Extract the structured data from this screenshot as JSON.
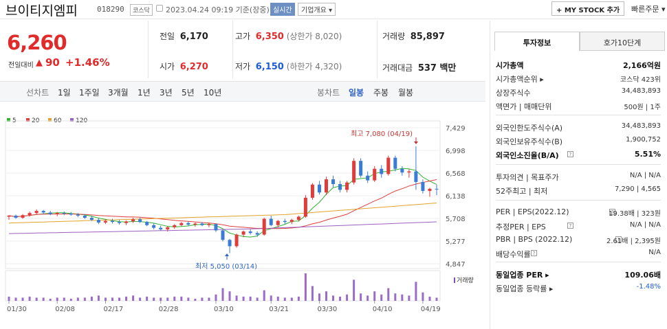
{
  "header": {
    "stock_name": "브이티지엠피",
    "code": "018290",
    "market": "코스닥",
    "datetime": "2023.04.24 09:19 기준(장중)",
    "realtime": "실시간",
    "company_info": "기업개요 ▾",
    "my_stock": "+ MY STOCK 추가",
    "quick_order": "빠른주문 ▾"
  },
  "price": {
    "current": "6,260",
    "change_label": "전일대비",
    "change_arrow": "▲",
    "change": "90",
    "change_pct": "+1.46%"
  },
  "quotes": {
    "prev_close_label": "전일",
    "prev_close": "6,170",
    "high_label": "고가",
    "high": "6,350",
    "upper_limit": "(상한가 8,020)",
    "volume_label": "거래량",
    "volume": "85,897",
    "open_label": "시가",
    "open": "6,270",
    "low_label": "저가",
    "low": "6,150",
    "lower_limit": "(하한가 4,320)",
    "amount_label": "거래대금",
    "amount": "537 백만"
  },
  "periods": {
    "line_label": "선차트",
    "items": [
      "1일",
      "1주일",
      "3개월",
      "1년",
      "3년",
      "5년",
      "10년"
    ],
    "candle_label": "봉차트",
    "candle_items": [
      "일봉",
      "주봉",
      "월봉"
    ],
    "candle_active": "일봉"
  },
  "legend": {
    "ma5": "5",
    "ma20": "20",
    "ma60": "60",
    "ma120": "120",
    "color5": "#2db32d",
    "color20": "#e03c3c",
    "color60": "#e3a22a",
    "color120": "#9b5fc0"
  },
  "chart_data": {
    "type": "candlestick",
    "y_ticks": [
      "7,429",
      "6,998",
      "6,568",
      "6,138",
      "5,708",
      "5,277",
      "4,847"
    ],
    "ylim": [
      4847,
      7429
    ],
    "x_ticks": [
      "01/30",
      "02/08",
      "02/17",
      "02/28",
      "03/10",
      "03/21",
      "03/30",
      "04/10",
      "04/19"
    ],
    "high_note": "최고 7,080 (04/19)",
    "low_note": "최저 5,050 (03/14)",
    "volume_label": "거래량",
    "up_color": "#e03c3c",
    "down_color": "#3a7bd5",
    "candles": [
      [
        5740,
        5770,
        5680,
        5760
      ],
      [
        5760,
        5780,
        5700,
        5720
      ],
      [
        5720,
        5790,
        5700,
        5770
      ],
      [
        5770,
        5840,
        5740,
        5810
      ],
      [
        5810,
        5880,
        5780,
        5850
      ],
      [
        5850,
        5870,
        5790,
        5820
      ],
      [
        5820,
        5850,
        5770,
        5790
      ],
      [
        5790,
        5830,
        5750,
        5810
      ],
      [
        5810,
        5840,
        5770,
        5800
      ],
      [
        5800,
        5830,
        5760,
        5780
      ],
      [
        5780,
        5810,
        5730,
        5760
      ],
      [
        5760,
        5790,
        5700,
        5720
      ],
      [
        5720,
        5760,
        5660,
        5680
      ],
      [
        5680,
        5720,
        5600,
        5630
      ],
      [
        5630,
        5690,
        5600,
        5660
      ],
      [
        5660,
        5700,
        5610,
        5640
      ],
      [
        5640,
        5680,
        5590,
        5620
      ],
      [
        5620,
        5670,
        5580,
        5650
      ],
      [
        5650,
        5720,
        5620,
        5690
      ],
      [
        5690,
        5720,
        5620,
        5640
      ],
      [
        5640,
        5660,
        5560,
        5580
      ],
      [
        5580,
        5620,
        5500,
        5530
      ],
      [
        5530,
        5570,
        5470,
        5500
      ],
      [
        5500,
        5560,
        5460,
        5540
      ],
      [
        5540,
        5600,
        5510,
        5580
      ],
      [
        5580,
        5640,
        5560,
        5620
      ],
      [
        5620,
        5650,
        5560,
        5590
      ],
      [
        5590,
        5630,
        5550,
        5610
      ],
      [
        5610,
        5640,
        5560,
        5580
      ],
      [
        5580,
        5620,
        5540,
        5600
      ],
      [
        5600,
        5610,
        5450,
        5480
      ],
      [
        5480,
        5500,
        5270,
        5300
      ],
      [
        5300,
        5320,
        5050,
        5180
      ],
      [
        5180,
        5420,
        5150,
        5400
      ],
      [
        5400,
        5480,
        5350,
        5460
      ],
      [
        5460,
        5500,
        5400,
        5430
      ],
      [
        5430,
        5460,
        5360,
        5400
      ],
      [
        5400,
        5720,
        5380,
        5700
      ],
      [
        5700,
        5760,
        5560,
        5580
      ],
      [
        5580,
        5680,
        5540,
        5660
      ],
      [
        5660,
        5700,
        5600,
        5640
      ],
      [
        5640,
        5700,
        5600,
        5680
      ],
      [
        5680,
        5760,
        5650,
        5740
      ],
      [
        5740,
        6150,
        5720,
        6100
      ],
      [
        6100,
        6380,
        6060,
        6350
      ],
      [
        6350,
        6420,
        6160,
        6200
      ],
      [
        6200,
        6500,
        6150,
        6450
      ],
      [
        6450,
        6520,
        6300,
        6360
      ],
      [
        6360,
        6420,
        6200,
        6250
      ],
      [
        6250,
        6420,
        6200,
        6390
      ],
      [
        6390,
        6850,
        6350,
        6800
      ],
      [
        6800,
        6850,
        6480,
        6520
      ],
      [
        6520,
        6600,
        6380,
        6430
      ],
      [
        6430,
        6700,
        6400,
        6650
      ],
      [
        6650,
        6720,
        6480,
        6550
      ],
      [
        6550,
        6900,
        6520,
        6860
      ],
      [
        6860,
        6900,
        6600,
        6650
      ],
      [
        6650,
        6700,
        6520,
        6580
      ],
      [
        6580,
        6640,
        6480,
        6600
      ],
      [
        6600,
        7080,
        6250,
        6400
      ],
      [
        6400,
        6450,
        6180,
        6230
      ],
      [
        6230,
        6290,
        6120,
        6270
      ],
      [
        6270,
        6350,
        6150,
        6260
      ]
    ],
    "volumes": [
      4,
      3,
      3,
      4,
      3,
      3,
      2,
      3,
      3,
      2,
      3,
      3,
      4,
      5,
      3,
      3,
      3,
      4,
      5,
      3,
      4,
      3,
      3,
      3,
      4,
      4,
      3,
      2,
      3,
      3,
      6,
      12,
      9,
      5,
      4,
      4,
      3,
      10,
      5,
      4,
      3,
      3,
      4,
      26,
      14,
      7,
      9,
      5,
      4,
      6,
      20,
      7,
      5,
      9,
      6,
      12,
      7,
      6,
      5,
      18,
      8,
      4,
      3
    ]
  },
  "right_panel": {
    "tab_active": "투자정보",
    "tab_inactive": "호가10단계",
    "rows": [
      {
        "l": "시가총액",
        "r": "2,166억원",
        "bold": true
      },
      {
        "l": "시가총액순위 ▸",
        "r": "코스닥 423위"
      },
      {
        "l": "상장주식수",
        "r": "34,483,893"
      },
      {
        "l": "액면가 | 매매단위",
        "r": "500원 | 1주"
      },
      {
        "l": "외국인한도주식수(A)",
        "r": "34,483,893"
      },
      {
        "l": "외국인보유주식수(B)",
        "r": "1,900,752"
      },
      {
        "l": "외국인소진율(B/A)",
        "r": "5.51%",
        "bold": true,
        "q": true
      },
      {
        "l": "투자의견 | 목표주가",
        "r": "N/A | N/A"
      },
      {
        "l": "52주최고 | 최저",
        "r": "7,290 | 4,565"
      },
      {
        "l": "PER | EPS(2022.12)",
        "r": "19.38배 | 323원",
        "q": true
      },
      {
        "l": "추정PER | EPS",
        "r": "N/A | N/A",
        "q": true
      },
      {
        "l": "PBR | BPS (2022.12)",
        "r": "2.61배 | 2,395원",
        "q": true
      },
      {
        "l": "배당수익률",
        "r": "N/A",
        "q": true
      },
      {
        "l": "동일업종 PER ▸",
        "r": "109.06배",
        "bold": true
      },
      {
        "l": "동일업종 등락률 ▸",
        "r": "-1.48%",
        "neg": true
      }
    ]
  }
}
